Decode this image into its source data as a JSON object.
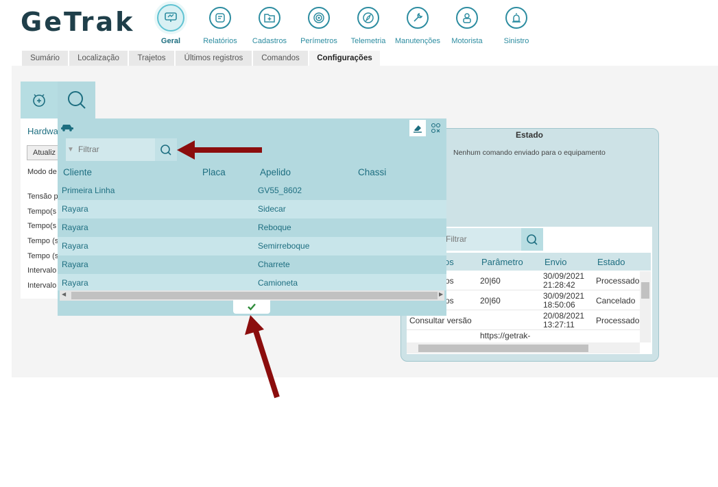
{
  "brand": {
    "logo_text": "GeTrak"
  },
  "nav": [
    {
      "label": "Geral",
      "icon": "monitor-icon",
      "active": true
    },
    {
      "label": "Relatórios",
      "icon": "report-icon"
    },
    {
      "label": "Cadastros",
      "icon": "folder-add-icon"
    },
    {
      "label": "Perímetros",
      "icon": "target-icon"
    },
    {
      "label": "Telemetria",
      "icon": "compass-icon"
    },
    {
      "label": "Manutenções",
      "icon": "wrench-icon"
    },
    {
      "label": "Motorista",
      "icon": "driver-icon"
    },
    {
      "label": "Sinistro",
      "icon": "alarm-icon"
    }
  ],
  "tabs": [
    "Sumário",
    "Localização",
    "Trajetos",
    "Últimos registros",
    "Comandos",
    "Configurações"
  ],
  "active_tab": "Configurações",
  "left_panel": {
    "heading": "Hardwa",
    "update_button": "Atualiz",
    "labels": [
      "Modo de",
      "Tensão p",
      "Tempo(s",
      "Tempo(s",
      "Tempo (s",
      "Tempo (s",
      "Intervalo",
      "Intervalo"
    ]
  },
  "modal": {
    "filter_placeholder": "Filtrar",
    "columns": [
      "Cliente",
      "Placa",
      "Apelido",
      "Chassi"
    ],
    "rows": [
      {
        "cliente": "Primeira Linha",
        "placa": "",
        "apelido": "GV55_8602",
        "chassi": ""
      },
      {
        "cliente": "Rayara",
        "placa": "",
        "apelido": "Sidecar",
        "chassi": ""
      },
      {
        "cliente": "Rayara",
        "placa": "",
        "apelido": "Reboque",
        "chassi": ""
      },
      {
        "cliente": "Rayara",
        "placa": "",
        "apelido": "Semirreboque",
        "chassi": ""
      },
      {
        "cliente": "Rayara",
        "placa": "",
        "apelido": "Charrete",
        "chassi": ""
      },
      {
        "cliente": "Rayara",
        "placa": "",
        "apelido": "Camioneta",
        "chassi": ""
      }
    ],
    "confirm_icon": "check-icon"
  },
  "estado": {
    "title": "Estado",
    "message": "Nenhum comando enviado para o equipamento",
    "filter_placeholder": "Filtrar",
    "columns": [
      "os",
      "Parâmetro",
      "Envio",
      "Estado"
    ],
    "rows": [
      {
        "comando": "os",
        "parametro": "20|60",
        "envio_date": "30/09/2021",
        "envio_time": "21:28:42",
        "estado": "Processado"
      },
      {
        "comando": "os",
        "parametro": "20|60",
        "envio_date": "30/09/2021",
        "envio_time": "18:50:06",
        "estado": "Cancelado"
      },
      {
        "comando": "Consultar versão",
        "parametro": "",
        "envio_date": "20/08/2021",
        "envio_time": "13:27:11",
        "estado": "Processado"
      },
      {
        "comando": "",
        "parametro": "https://getrak-",
        "envio_date": "",
        "envio_time": "",
        "estado": ""
      }
    ]
  },
  "colors": {
    "accent": "#2c8ca0",
    "panel": "#b3d9df",
    "arrow": "#8b0d0d"
  }
}
